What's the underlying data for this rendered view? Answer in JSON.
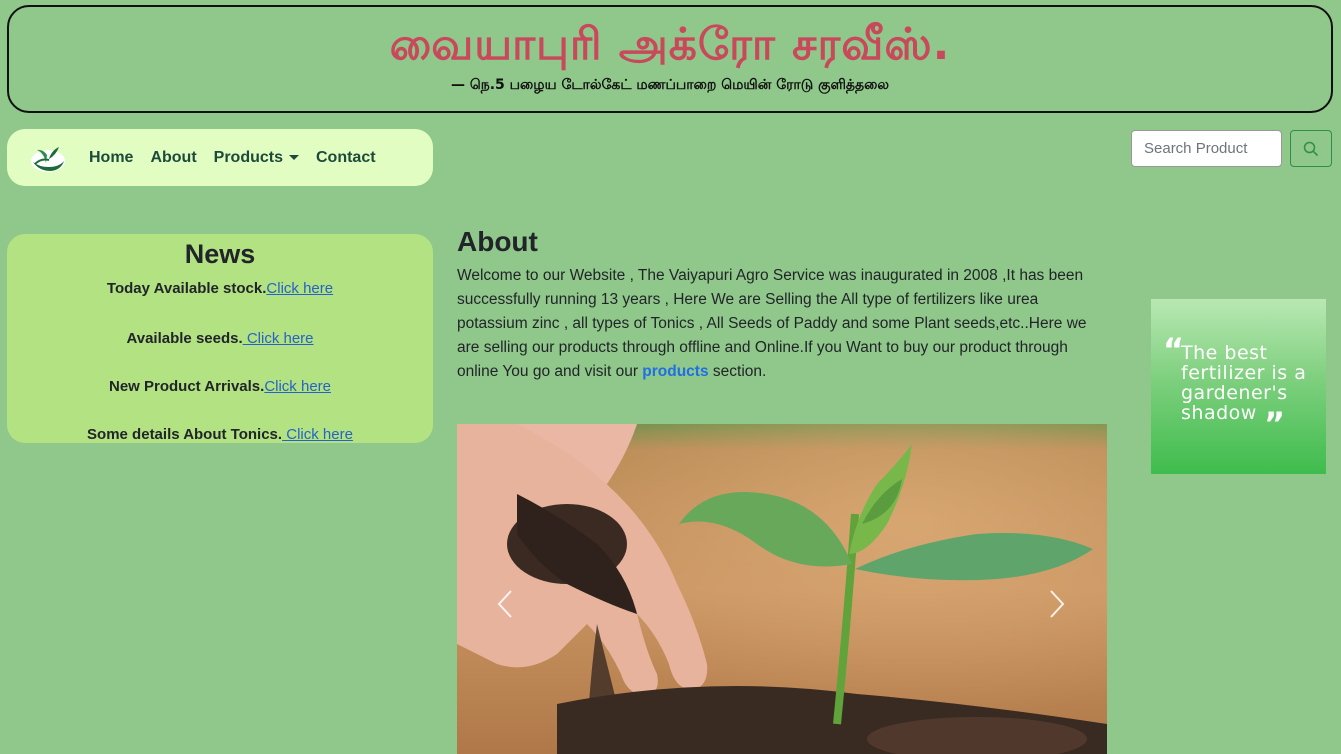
{
  "header": {
    "title": "வையாபுரி அக்ரோ சரவீஸ்.",
    "subtitle": "— நெ.5 பழைய டோல்கேட் மணப்பாறை மெயின் ரோடு குளித்தலை"
  },
  "nav": {
    "logo_icon": "plant-hand-logo",
    "items": [
      {
        "label": "Home"
      },
      {
        "label": "About"
      },
      {
        "label": "Products"
      },
      {
        "label": "Contact"
      }
    ]
  },
  "search": {
    "placeholder": "Search Product",
    "button_icon": "search-icon"
  },
  "news": {
    "title": "News",
    "items": [
      {
        "text": "Today Available stock.",
        "link": "Click here"
      },
      {
        "text": "Available seeds.",
        "link": " Click here"
      },
      {
        "text": "New Product Arrivals.",
        "link": "Click here"
      },
      {
        "text": "Some details About Tonics.",
        "link": " Click here"
      }
    ]
  },
  "about": {
    "title": "About",
    "text_before": "Welcome to our Website , The Vaiyapuri Agro Service was inaugurated in 2008 ,It has been successfully running 13 years , Here We are Selling the All type of fertilizers like urea potassium zinc , all types of Tonics , All Seeds of Paddy and some Plant seeds,etc..Here we are selling our products through offline and Online.If you Want to buy our product through online You go and visit our ",
    "link": "products",
    "text_after": " section."
  },
  "carousel": {
    "prev_icon": "chevron-left-icon",
    "next_icon": "chevron-right-icon"
  },
  "quote": {
    "text": "The best fertilizer is a gardener's shadow"
  },
  "colors": {
    "background": "#90c78a",
    "title": "#c9485b",
    "navbar": "#e1fdc2",
    "news_box": "#b3e283",
    "link": "#1f6fe5"
  }
}
